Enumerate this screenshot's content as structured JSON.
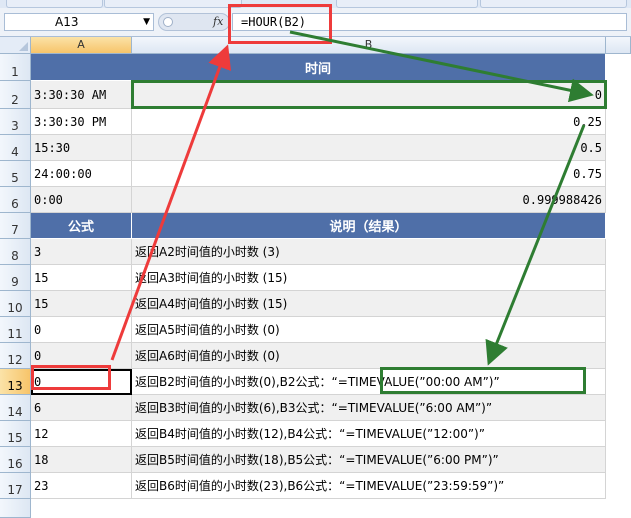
{
  "formula_bar": {
    "name_box": "A13",
    "fx_label": "fx",
    "formula": "=HOUR(B2)"
  },
  "columns": [
    "A",
    "B"
  ],
  "rows": [
    "1",
    "2",
    "3",
    "4",
    "5",
    "6",
    "7",
    "8",
    "9",
    "10",
    "11",
    "12",
    "13",
    "14",
    "15",
    "16",
    "17"
  ],
  "sheet": {
    "header1": "时间",
    "time_rows": [
      {
        "a": "3:30:30 AM",
        "b": "0"
      },
      {
        "a": "3:30:30 PM",
        "b": "0.25"
      },
      {
        "a": "15:30",
        "b": "0.5"
      },
      {
        "a": "24:00:00",
        "b": "0.75"
      },
      {
        "a": "0:00",
        "b": "0.999988426"
      }
    ],
    "header2_a": "公式",
    "header2_b": "说明（结果）",
    "result_rows": [
      {
        "a": "3",
        "b": "返回A2时间值的小时数 (3)"
      },
      {
        "a": "15",
        "b": "返回A3时间值的小时数 (15)"
      },
      {
        "a": "15",
        "b": "返回A4时间值的小时数 (15)"
      },
      {
        "a": "0",
        "b": "返回A5时间值的小时数 (0)"
      },
      {
        "a": "0",
        "b": "返回A6时间值的小时数 (0)"
      },
      {
        "a": "0",
        "b": "返回B2时间值的小时数(0),B2公式：“=TIMEVALUE(”00:00 AM”)”"
      },
      {
        "a": "6",
        "b": "返回B3时间值的小时数(6),B3公式：“=TIMEVALUE(”6:00 AM”)”"
      },
      {
        "a": "12",
        "b": "返回B4时间值的小时数(12),B4公式：“=TIMEVALUE(”12:00”)”"
      },
      {
        "a": "18",
        "b": "返回B5时间值的小时数(18),B5公式：“=TIMEVALUE(”6:00 PM”)”"
      },
      {
        "a": "23",
        "b": "返回B6时间值的小时数(23),B6公式：“=TIMEVALUE(”23:59:59”)”"
      }
    ]
  },
  "colors": {
    "header_fill": "#4f6fa8",
    "annotation_red": "#ee3b3b",
    "annotation_green": "#2e7d32"
  }
}
